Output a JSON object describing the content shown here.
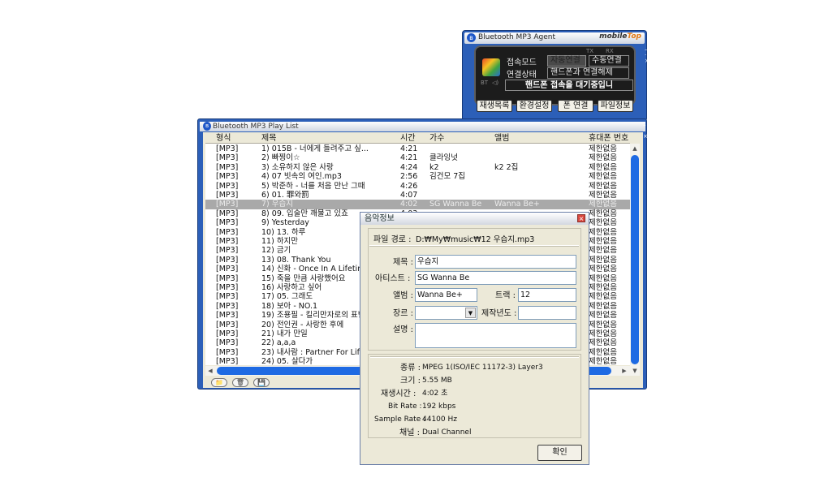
{
  "agent": {
    "title": "Bluetooth MP3 Agent",
    "logo_prefix": "mobile",
    "logo_suffix": "Top",
    "tiny_labels": [
      "TX",
      "RX"
    ],
    "status_icons": [
      "BT",
      "◁)"
    ],
    "mode_label": "접속모드",
    "mode_options": [
      "자동연결",
      "수동연결"
    ],
    "conn_label": "연결상태",
    "conn_value": "핸드폰과 연결해제",
    "message": "핸드폰 접속을 대기중입니",
    "buttons": [
      "재생목록",
      "환경설정",
      "폰 연결",
      "파일정보"
    ]
  },
  "playlist": {
    "title": "Bluetooth MP3 Play List",
    "columns": [
      "형식",
      "제목",
      "시간",
      "가수",
      "앨범",
      "휴대폰 번호"
    ],
    "selected_index": 6,
    "rows": [
      [
        "[MP3]",
        "1) 015B - 너에게 들려주고 싶...",
        "4:21",
        "",
        "",
        "제한없음"
      ],
      [
        "[MP3]",
        "2) 빠찡이☆",
        "4:21",
        "클라잉넛",
        "",
        "제한없음"
      ],
      [
        "[MP3]",
        "3) 소유하지 않은 사랑",
        "4:24",
        "k2",
        "k2 2집",
        "제한없음"
      ],
      [
        "[MP3]",
        "4) 07 빗속의 여인.mp3",
        "2:56",
        "김건모 7집",
        "",
        "제한없음"
      ],
      [
        "[MP3]",
        "5) 박준하 - 너를 처음 만난 그때",
        "4:26",
        "",
        "",
        "제한없음"
      ],
      [
        "[MP3]",
        "6) 01. 罪와罰",
        "4:07",
        "",
        "",
        "제한없음"
      ],
      [
        "[MP3]",
        "7) 우습지",
        "4:02",
        "SG Wanna Be",
        "Wanna Be+",
        "제한없음"
      ],
      [
        "[MP3]",
        "8) 09. 입술만 깨물고 있죠",
        "4:03",
        "",
        "",
        "제한없음"
      ],
      [
        "[MP3]",
        "9) Yesterday",
        "",
        "",
        "",
        "제한없음"
      ],
      [
        "[MP3]",
        "10) 13. 하루",
        "",
        "",
        "",
        "제한없음"
      ],
      [
        "[MP3]",
        "11) 하지만",
        "",
        "",
        "",
        "제한없음"
      ],
      [
        "[MP3]",
        "12) 금기",
        "",
        "",
        "",
        "제한없음"
      ],
      [
        "[MP3]",
        "13) 08. Thank You",
        "",
        "",
        "",
        "제한없음"
      ],
      [
        "[MP3]",
        "14) 신화 - Once In A Lifetime",
        "",
        "",
        "",
        "제한없음"
      ],
      [
        "[MP3]",
        "15) 죽을 만큼 사랑했어요",
        "",
        "",
        "",
        "제한없음"
      ],
      [
        "[MP3]",
        "16) 사랑하고 싶어",
        "",
        "",
        "",
        "제한없음"
      ],
      [
        "[MP3]",
        "17) 05. 그래도",
        "",
        "",
        "",
        "제한없음"
      ],
      [
        "[MP3]",
        "18) 보아 - NO.1",
        "",
        "",
        "",
        "제한없음"
      ],
      [
        "[MP3]",
        "19) 조용필 - 킬리만자로의 표범",
        "",
        "",
        "",
        "제한없음"
      ],
      [
        "[MP3]",
        "20) 전인권 - 사랑한 후에",
        "",
        "",
        "",
        "제한없음"
      ],
      [
        "[MP3]",
        "21) 내가 만일",
        "",
        "",
        "",
        "제한없음"
      ],
      [
        "[MP3]",
        "22) a,a,a",
        "",
        "",
        "",
        "제한없음"
      ],
      [
        "[MP3]",
        "23) 내사람 : Partner For Life",
        "",
        "",
        "",
        "제한없음"
      ],
      [
        "[MP3]",
        "24) 05. 살다가",
        "",
        "",
        "",
        "제한없음"
      ]
    ],
    "bottom_icons": [
      "📁",
      "🗑",
      "💾"
    ],
    "scroll_up": "▲",
    "scroll_down": "▼",
    "scroll_left": "◀",
    "scroll_right": "▶"
  },
  "dialog": {
    "title": "음악정보",
    "close": "×",
    "path_label": "파일 경로 :",
    "path_value": "D:₩My₩music₩12 우습지.mp3",
    "title_label": "제목 :",
    "title_value": "우습지",
    "artist_label": "아티스트 :",
    "artist_value": "SG Wanna Be",
    "album_label": "앨범 :",
    "album_value": "Wanna Be+",
    "track_label": "트랙 :",
    "track_value": "12",
    "genre_label": "장르 :",
    "genre_value": "",
    "year_label": "제작년도 :",
    "year_value": "",
    "desc_label": "설명 :",
    "desc_value": "",
    "type_label": "종류 :",
    "type_value": "MPEG 1(ISO/IEC 11172-3) Layer3",
    "size_label": "크기 :",
    "size_value": "5.55 MB",
    "duration_label": "재생시간 :",
    "duration_value": "4:02 초",
    "bitrate_label": "Bit Rate :",
    "bitrate_value": "192 kbps",
    "samplerate_label": "Sample Rate :",
    "samplerate_value": "44100 Hz",
    "channel_label": "채널 :",
    "channel_value": "Dual Channel",
    "ok_label": "확인"
  }
}
